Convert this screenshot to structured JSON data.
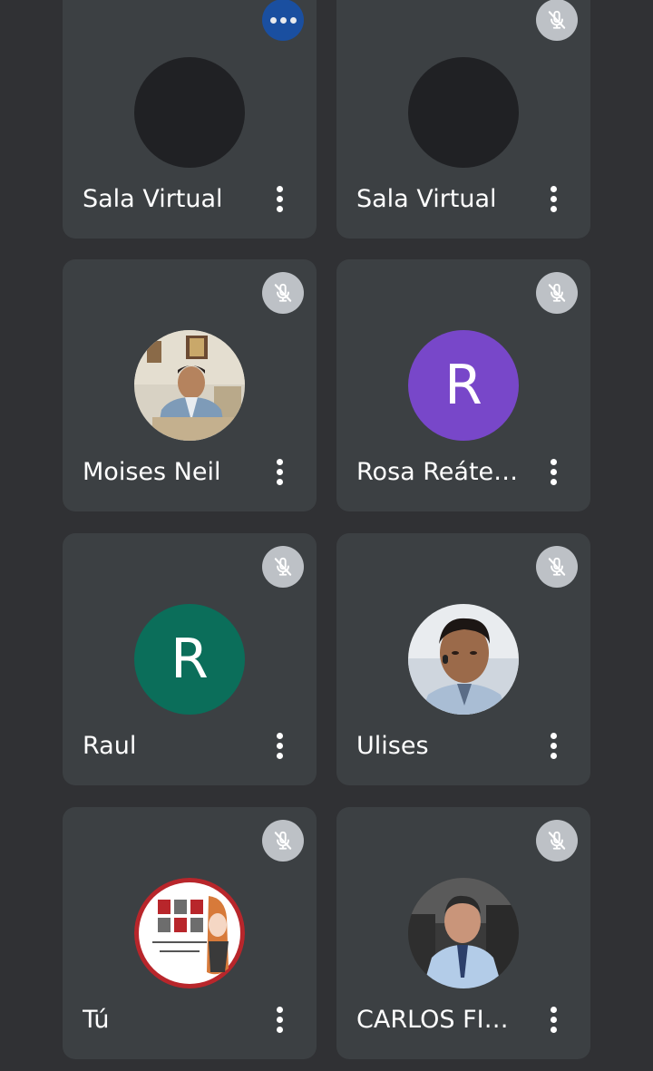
{
  "participants": [
    {
      "name": "Sala Virtual",
      "avatar": {
        "type": "blank",
        "color": "#202124"
      },
      "status_icon": "more-options-icon"
    },
    {
      "name": "Sala Virtual",
      "avatar": {
        "type": "blank",
        "color": "#202124"
      },
      "status_icon": "mic-off-icon"
    },
    {
      "name": "Moises Neil",
      "avatar": {
        "type": "photo",
        "icon": "man-in-suit-photo"
      },
      "status_icon": "mic-off-icon"
    },
    {
      "name": "Rosa Reáte…",
      "avatar": {
        "type": "initial",
        "letter": "R",
        "color": "#7847c9"
      },
      "status_icon": "mic-off-icon"
    },
    {
      "name": "Raul",
      "avatar": {
        "type": "initial",
        "letter": "R",
        "color": "#0b6e5a"
      },
      "status_icon": "mic-off-icon"
    },
    {
      "name": "Ulises",
      "avatar": {
        "type": "photo",
        "icon": "man-portrait-photo"
      },
      "status_icon": "mic-off-icon"
    },
    {
      "name": "Tú",
      "avatar": {
        "type": "logo",
        "icon": "court-logo"
      },
      "status_icon": "mic-off-icon"
    },
    {
      "name": "CARLOS FI…",
      "avatar": {
        "type": "photo",
        "icon": "man-in-car-photo"
      },
      "status_icon": "mic-off-icon"
    }
  ],
  "colors": {
    "background": "#303134",
    "tile": "#3c4043",
    "text": "#ffffff",
    "mic_badge": "#bdc1c6",
    "more_badge": "#1a4fa0"
  }
}
